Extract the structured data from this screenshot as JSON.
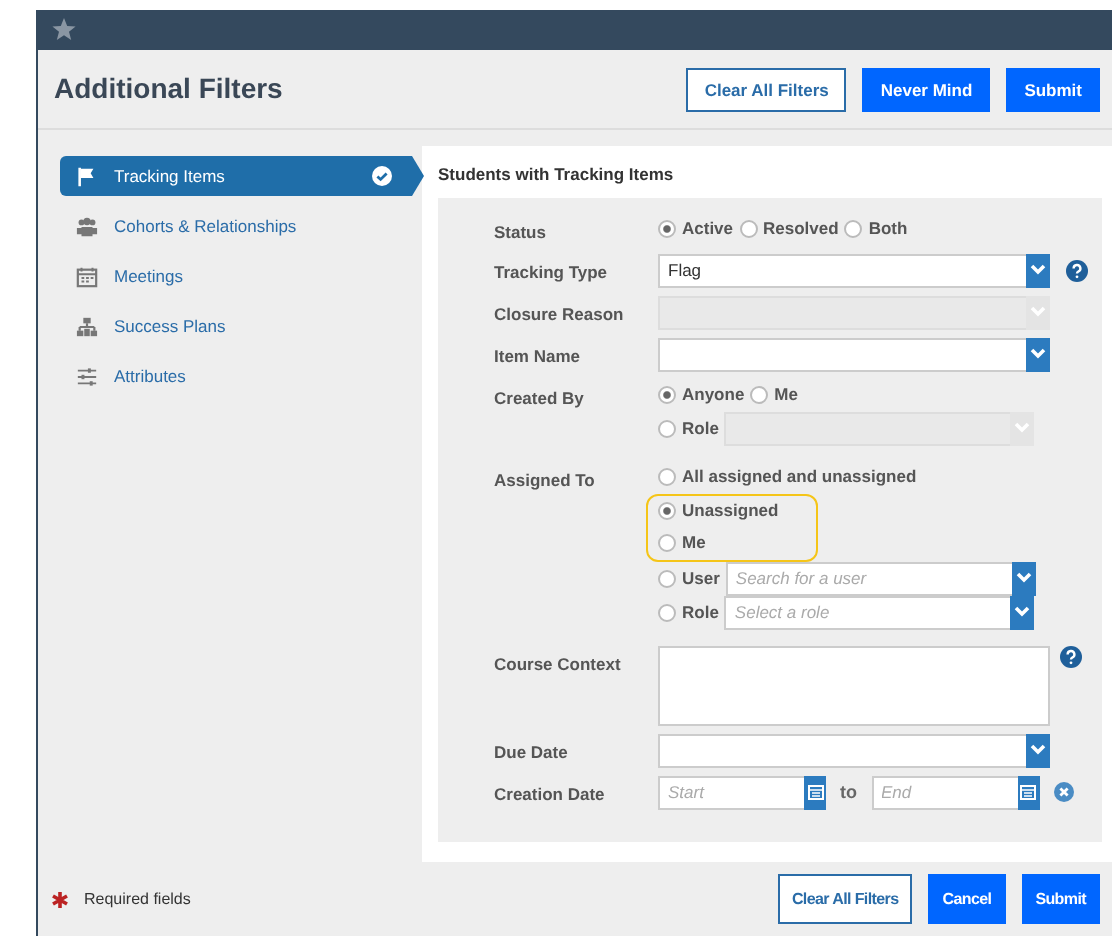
{
  "window": {
    "title": "Additional Filters"
  },
  "header_buttons": [
    {
      "label": "Clear All Filters",
      "kind": "outline"
    },
    {
      "label": "Never Mind",
      "kind": "primary"
    },
    {
      "label": "Submit",
      "kind": "primary"
    }
  ],
  "sidebar": {
    "items": [
      {
        "label": "Tracking Items",
        "selected": true,
        "done": true
      },
      {
        "label": "Cohorts & Relationships",
        "selected": false,
        "done": false
      },
      {
        "label": "Meetings",
        "selected": false,
        "done": false
      },
      {
        "label": "Success Plans",
        "selected": false,
        "done": false
      },
      {
        "label": "Attributes",
        "selected": false,
        "done": false
      }
    ]
  },
  "section_title": "Students with Tracking Items",
  "form": {
    "rows": [
      {
        "label": "Status",
        "kind": "radios",
        "lines": [
          {
            "highlighted": false,
            "options": [
              {
                "label": "Active",
                "selected": true
              },
              {
                "label": "Resolved",
                "selected": false
              },
              {
                "label": "Both",
                "selected": false
              }
            ]
          }
        ]
      },
      {
        "label": "Tracking Type",
        "kind": "select",
        "value": "Flag",
        "disabled": false,
        "help": true
      },
      {
        "label": "Closure Reason",
        "kind": "select",
        "disabled": true,
        "help": false
      },
      {
        "label": "Item Name",
        "kind": "select",
        "disabled": false,
        "help": false
      },
      {
        "label": "Created By",
        "kind": "radios",
        "lines": [
          {
            "highlighted": false,
            "options": [
              {
                "label": "Anyone",
                "selected": true
              },
              {
                "label": "Me",
                "selected": false
              }
            ]
          },
          {
            "highlighted": false,
            "options": [
              {
                "label": "Role",
                "selected": false,
                "field": {
                  "disabled": true
                }
              }
            ]
          }
        ]
      },
      {
        "label": "Assigned To",
        "kind": "radios",
        "lines": [
          {
            "highlighted": false,
            "options": [
              {
                "label": "All assigned and unassigned",
                "selected": false
              }
            ]
          },
          {
            "highlighted": true,
            "options": [
              {
                "label": "Unassigned",
                "selected": true
              }
            ]
          },
          {
            "highlighted": true,
            "options": [
              {
                "label": "Me",
                "selected": false
              }
            ]
          },
          {
            "highlighted": false,
            "options": [
              {
                "label": "User",
                "selected": false,
                "field": {
                  "placeholder": "Search for a user",
                  "disabled": false
                }
              }
            ]
          },
          {
            "highlighted": false,
            "options": [
              {
                "label": "Role",
                "selected": false,
                "field": {
                  "placeholder": "Select a role",
                  "disabled": false
                }
              }
            ]
          }
        ]
      },
      {
        "label": "Course Context",
        "kind": "textarea",
        "help": true
      },
      {
        "label": "Due Date",
        "kind": "select",
        "disabled": false,
        "help": false
      },
      {
        "label": "Creation Date",
        "kind": "daterange",
        "start_placeholder": "Start",
        "joiner": "to",
        "end_placeholder": "End",
        "clearable": true
      }
    ]
  },
  "footer": {
    "required_note": "Required fields",
    "buttons": [
      {
        "label": "Clear All Filters",
        "kind": "outline"
      },
      {
        "label": "Cancel",
        "kind": "primary"
      },
      {
        "label": "Submit",
        "kind": "primary"
      }
    ]
  }
}
